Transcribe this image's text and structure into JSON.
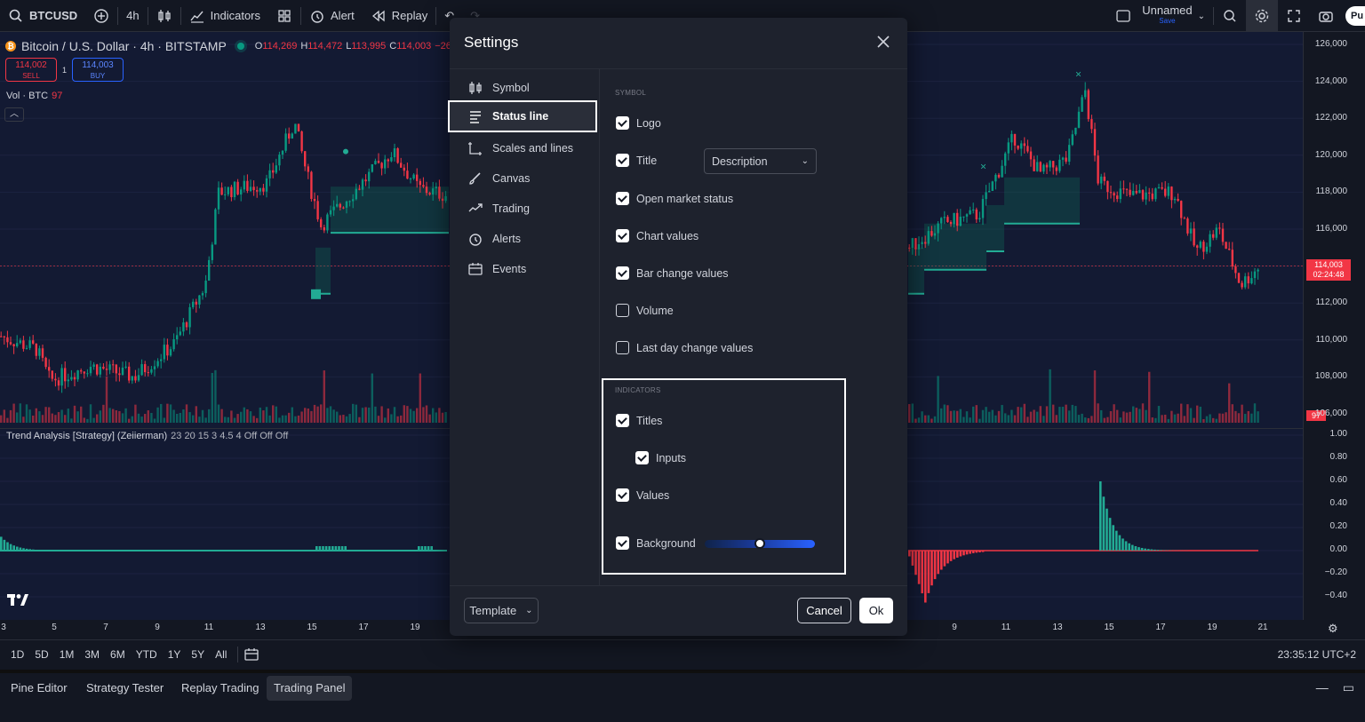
{
  "toolbar": {
    "symbol": "BTCUSD",
    "interval": "4h",
    "indicators_label": "Indicators",
    "alert_label": "Alert",
    "replay_label": "Replay",
    "layout_name": "Unnamed",
    "layout_status": "Save",
    "publish_label": "Pu"
  },
  "legend": {
    "symbol_line": "Bitcoin / U.S. Dollar · 4h · BITSTAMP",
    "coin_glyph": "₿",
    "ohlc": [
      {
        "k": "O",
        "v": "114,269"
      },
      {
        "k": "H",
        "v": "114,472"
      },
      {
        "k": "L",
        "v": "113,995"
      },
      {
        "k": "C",
        "v": "114,003"
      },
      {
        "k": "",
        "v": "−26"
      }
    ],
    "sell_price": "114,002",
    "sell_label": "SELL",
    "spread": "1",
    "buy_price": "114,003",
    "buy_label": "BUY",
    "volume_label": "Vol · BTC",
    "volume_value": "97",
    "indicator_title": "Trend Analysis [Strategy] (Zeiierman)",
    "indicator_params": "23 20 15 3 4.5 4  Off Off Off"
  },
  "price_axis": {
    "labels": [
      "126,000",
      "124,000",
      "122,000",
      "120,000",
      "118,000",
      "116,000",
      "112,000",
      "110,000",
      "108,000",
      "106,000"
    ],
    "last_price": "114,003",
    "countdown": "02:24:48",
    "volume_tag": "97",
    "osc_labels": [
      "1.00",
      "0.80",
      "0.60",
      "0.40",
      "0.20",
      "0.00",
      "−0.20",
      "−0.40"
    ]
  },
  "time_axis": {
    "ticks": [
      "3",
      "5",
      "7",
      "9",
      "11",
      "13",
      "15",
      "17",
      "19",
      "9",
      "11",
      "13",
      "15",
      "17",
      "19",
      "21"
    ]
  },
  "range_bar": {
    "ranges": [
      "1D",
      "5D",
      "1M",
      "3M",
      "6M",
      "YTD",
      "1Y",
      "5Y",
      "All"
    ],
    "clock": "23:35:12 UTC+2"
  },
  "bottom_tabs": [
    "Pine Editor",
    "Strategy Tester",
    "Replay Trading",
    "Trading Panel"
  ],
  "settings": {
    "title": "Settings",
    "nav": [
      {
        "label": "Symbol",
        "icon": "candles-icon"
      },
      {
        "label": "Status line",
        "icon": "status-line-icon"
      },
      {
        "label": "Scales and lines",
        "icon": "scales-icon"
      },
      {
        "label": "Canvas",
        "icon": "brush-icon"
      },
      {
        "label": "Trading",
        "icon": "trading-icon"
      },
      {
        "label": "Alerts",
        "icon": "alarm-clock-icon"
      },
      {
        "label": "Events",
        "icon": "calendar-icon"
      }
    ],
    "symbol_section": "SYMBOL",
    "symbol_options": [
      {
        "label": "Logo",
        "checked": true
      },
      {
        "label": "Title",
        "checked": true
      },
      {
        "label": "Open market status",
        "checked": true
      },
      {
        "label": "Chart values",
        "checked": true
      },
      {
        "label": "Bar change values",
        "checked": true
      },
      {
        "label": "Volume",
        "checked": false
      },
      {
        "label": "Last day change values",
        "checked": false
      }
    ],
    "title_select_value": "Description",
    "indicators_section": "INDICATORS",
    "indicator_options": [
      {
        "label": "Titles",
        "checked": true
      },
      {
        "label": "Inputs",
        "checked": true
      },
      {
        "label": "Values",
        "checked": true
      },
      {
        "label": "Background",
        "checked": true
      }
    ],
    "background_opacity": 0.5,
    "template_label": "Template",
    "cancel_label": "Cancel",
    "ok_label": "Ok"
  },
  "colors": {
    "up": "#089981",
    "down": "#f23645",
    "accent": "#2962ff",
    "chart_bg": "#131a33"
  }
}
